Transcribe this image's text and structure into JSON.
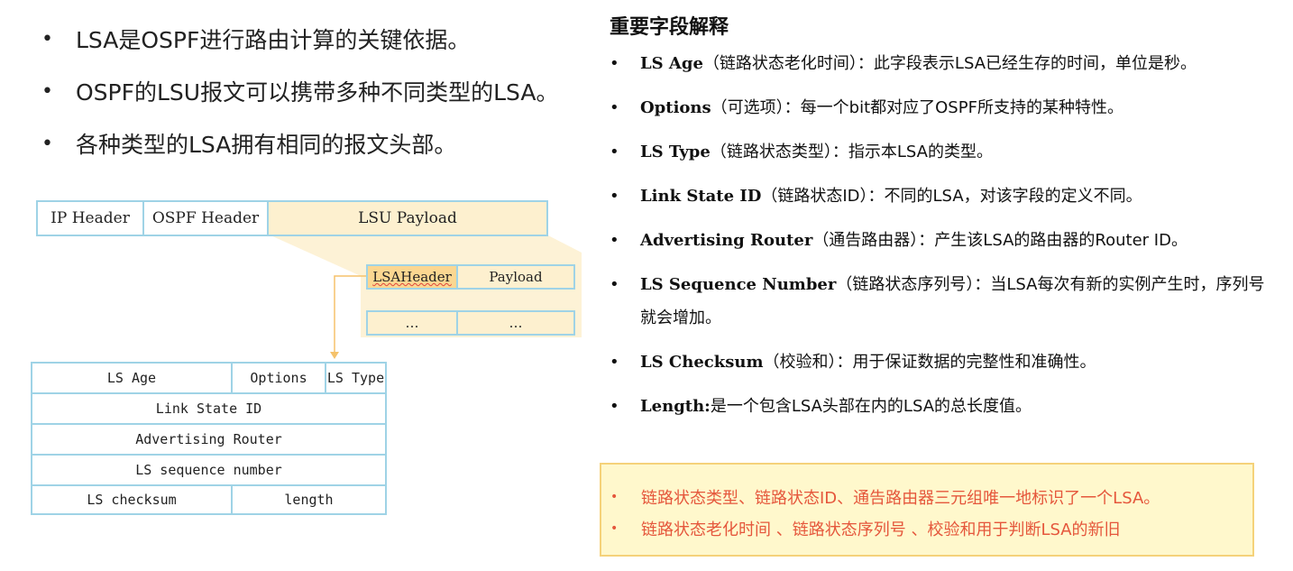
{
  "left_bullets": [
    "LSA是OSPF进行路由计算的关键依据。",
    "OSPF的LSU报文可以携带多种不同类型的LSA。",
    "各种类型的LSA拥有相同的报文头部。"
  ],
  "packet": {
    "ip_header": "IP Header",
    "ospf_header": "OSPF Header",
    "lsu_payload": "LSU Payload",
    "lsa_header": "LSAHeader",
    "payload": "Payload",
    "ellipsis_1": "…",
    "ellipsis_2": "…"
  },
  "lsa_header_fields": {
    "ls_age": "LS Age",
    "options": "Options",
    "ls_type": "LS Type",
    "link_state_id": "Link State ID",
    "advertising_router": "Advertising Router",
    "ls_sequence_number": "LS sequence number",
    "ls_checksum": "LS checksum",
    "length": "length"
  },
  "right_title": "重要字段解释",
  "field_explanations": [
    {
      "term": "LS Age",
      "desc": "（链路状态老化时间）：此字段表示LSA已经生存的时间，单位是秒。"
    },
    {
      "term": "Options",
      "desc": "（可选项）：每一个bit都对应了OSPF所支持的某种特性。"
    },
    {
      "term": "LS Type",
      "desc": "（链路状态类型）：指示本LSA的类型。"
    },
    {
      "term": "Link State ID",
      "desc": "（链路状态ID）：不同的LSA，对该字段的定义不同。"
    },
    {
      "term": "Advertising Router",
      "desc": "（通告路由器）：产生该LSA的路由器的Router ID。"
    },
    {
      "term": "LS Sequence Number",
      "desc": "（链路状态序列号）：当LSA每次有新的实例产生时，序列号就会增加。"
    },
    {
      "term": "LS Checksum",
      "desc": "（校验和）：用于保证数据的完整性和准确性。"
    },
    {
      "term": "Length:",
      "desc": "是一个包含LSA头部在内的LSA的总长度值。"
    }
  ],
  "notes": [
    "链路状态类型、链路状态ID、通告路由器三元组唯一地标识了一个LSA。",
    "链路状态老化时间 、链路状态序列号 、校验和用于判断LSA的新旧"
  ],
  "colors": {
    "table_border": "#9fd3e6",
    "payload_fill": "#fdf0cf",
    "lsa_header_fill": "#fbd791",
    "note_background": "#fff8cc",
    "note_text": "#e5573c"
  }
}
